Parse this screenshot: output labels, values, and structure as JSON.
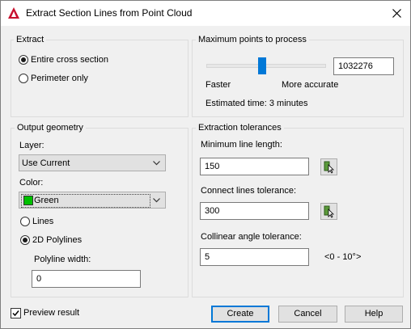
{
  "window": {
    "title": "Extract Section Lines from Point Cloud"
  },
  "extract": {
    "legend": "Extract",
    "options": [
      "Entire cross section",
      "Perimeter only"
    ],
    "selected": 0
  },
  "max_points": {
    "legend": "Maximum points to process",
    "value": "1032276",
    "slider_level": 0.47,
    "left_label": "Faster",
    "right_label": "More accurate",
    "estimated": "Estimated time: 3 minutes"
  },
  "output": {
    "legend": "Output geometry",
    "layer_label": "Layer:",
    "layer_value": "Use Current",
    "color_label": "Color:",
    "color_value": "Green",
    "color_swatch": "#00c000",
    "geom_options": [
      "Lines",
      "2D Polylines"
    ],
    "geom_selected": 1,
    "polyline_width_label": "Polyline width:",
    "polyline_width_value": "0"
  },
  "tolerances": {
    "legend": "Extraction tolerances",
    "min_line_label": "Minimum line length:",
    "min_line_value": "150",
    "connect_label": "Connect lines tolerance:",
    "connect_value": "300",
    "collinear_label": "Collinear angle tolerance:",
    "collinear_value": "5",
    "collinear_range": "<0 - 10°>"
  },
  "footer": {
    "preview_label": "Preview result",
    "preview_checked": true,
    "create_label": "Create",
    "cancel_label": "Cancel",
    "help_label": "Help"
  },
  "icons": {
    "app": "autocad-logo-icon",
    "close": "close-icon",
    "pick": "pick-point-icon",
    "dropdown": "chevron-down-icon"
  }
}
